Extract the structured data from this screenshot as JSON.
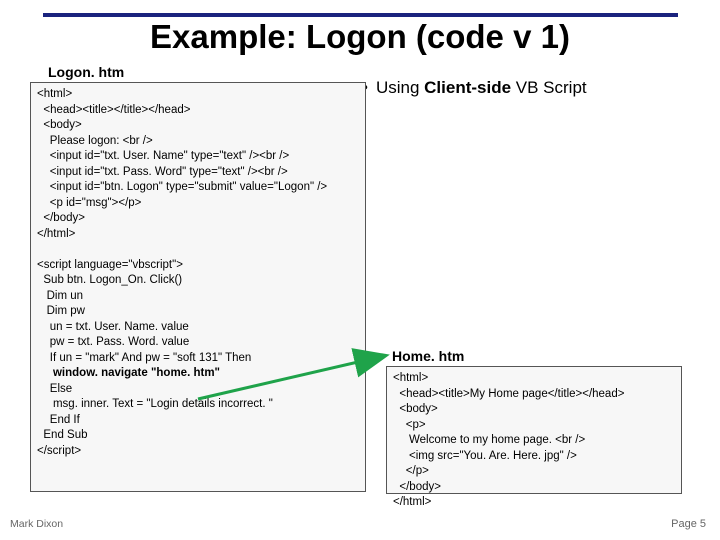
{
  "title": "Example: Logon (code v 1)",
  "label_logon": "Logon. htm",
  "bullet_using_pre": "Using ",
  "bullet_using_bold": "Client-side",
  "bullet_using_post": " VB Script",
  "code1_html": "<html>\n  <head><title></title></head>\n  <body>\n    Please logon: <br />\n    <input id=\"txt. User. Name\" type=\"text\" /><br />\n    <input id=\"txt. Pass. Word\" type=\"text\" /><br />\n    <input id=\"btn. Logon\" type=\"submit\" value=\"Logon\" />\n    <p id=\"msg\"></p>\n  </body>\n</html>",
  "code1_script_open": "<script language=\"vbscript\">",
  "code1_line_sub": "  Sub btn. Logon_On. Click()",
  "code1_line_dimun": "   Dim un",
  "code1_line_dimpw": "   Dim pw",
  "code1_line_un": "    un = txt. User. Name. value",
  "code1_line_pw": "    pw = txt. Pass. Word. value",
  "code1_line_if": "    If un = \"mark\" And pw = \"soft 131\" Then",
  "code1_line_nav": "     window. navigate \"home. htm\"",
  "code1_line_else": "    Else",
  "code1_line_msg": "     msg. inner. Text = \"Login details incorrect. \"",
  "code1_line_endif": "    End If",
  "code1_line_endsub": "  End Sub",
  "code1_script_close": "</scr",
  "code1_script_close2": "ipt>",
  "label_home": "Home. htm",
  "code2": "<html>\n  <head><title>My Home page</title></head>\n  <body>\n    <p>\n     Welcome to my home page. <br />\n     <img src=\"You. Are. Here. jpg\" />\n    </p>\n  </body>\n</html>",
  "footer_left": "Mark Dixon",
  "footer_right": "Page 5"
}
